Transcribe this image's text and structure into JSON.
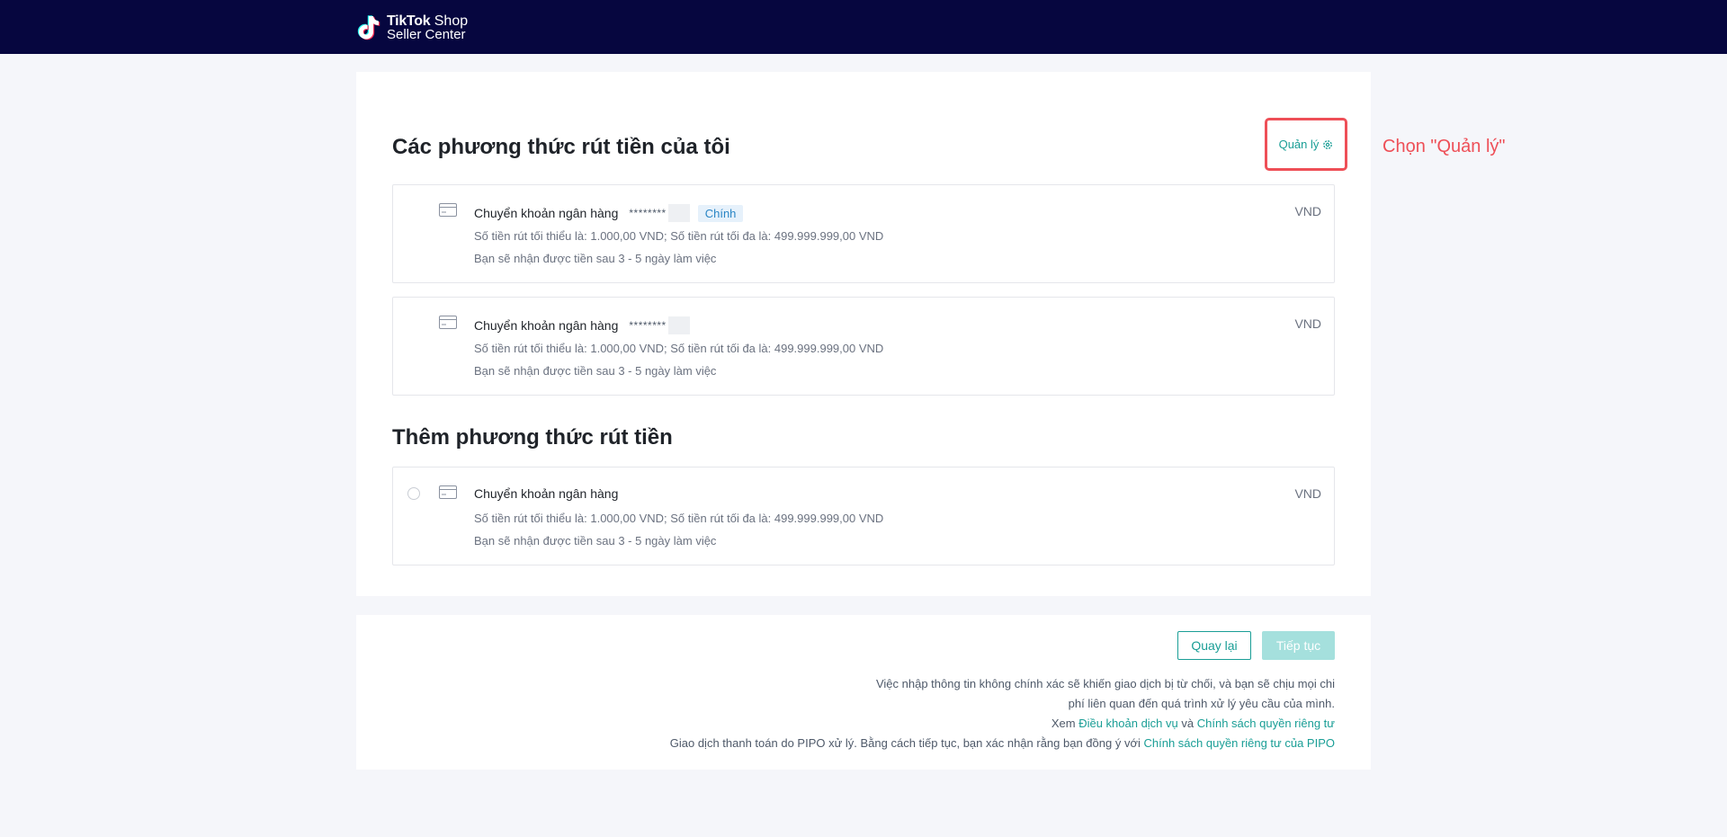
{
  "header": {
    "logo_brand": "TikTok",
    "logo_shop": "Shop",
    "logo_sub": "Seller Center"
  },
  "my_methods": {
    "title": "Các phương thức rút tiền của tôi",
    "manage_label": "Quản lý",
    "items": [
      {
        "name": "Chuyển khoản ngân hàng",
        "account_mask": "********",
        "badge": "Chính",
        "limits": "Số tiền rút tối thiểu là: 1.000,00 VND; Số tiền rút tối đa là: 499.999.999,00 VND",
        "eta": "Bạn sẽ nhận được tiền sau 3 - 5 ngày làm việc",
        "currency": "VND"
      },
      {
        "name": "Chuyển khoản ngân hàng",
        "account_mask": "********",
        "limits": "Số tiền rút tối thiểu là: 1.000,00 VND; Số tiền rút tối đa là: 499.999.999,00 VND",
        "eta": "Bạn sẽ nhận được tiền sau 3 - 5 ngày làm việc",
        "currency": "VND"
      }
    ]
  },
  "annotation": "Chọn \"Quản lý\"",
  "add_methods": {
    "title": "Thêm phương thức rút tiền",
    "items": [
      {
        "name": "Chuyển khoản ngân hàng",
        "limits": "Số tiền rút tối thiểu là: 1.000,00 VND; Số tiền rút tối đa là: 499.999.999,00 VND",
        "eta": "Bạn sẽ nhận được tiền sau 3 - 5 ngày làm việc",
        "currency": "VND"
      }
    ]
  },
  "footer": {
    "back_label": "Quay lại",
    "next_label": "Tiếp tục",
    "notice_line1": "Việc nhập thông tin không chính xác sẽ khiến giao dịch bị từ chối, và bạn sẽ chịu mọi chi",
    "notice_line2": "phí liên quan đến quá trình xử lý yêu cầu của mình.",
    "view_prefix": "Xem",
    "terms_link": "Điều khoản dịch vụ",
    "and_word": "và",
    "privacy_link": "Chính sách quyền riêng tư",
    "pipo_text": "Giao dịch thanh toán do PIPO xử lý. Bằng cách tiếp tục, bạn xác nhận rằng bạn đồng ý với",
    "pipo_link": "Chính sách quyền riêng tư của PIPO"
  },
  "colors": {
    "header_bg": "#06063f",
    "accent": "#1a9e96",
    "annotation_red": "#ee4f57",
    "badge_blue": "#2b86c5"
  }
}
